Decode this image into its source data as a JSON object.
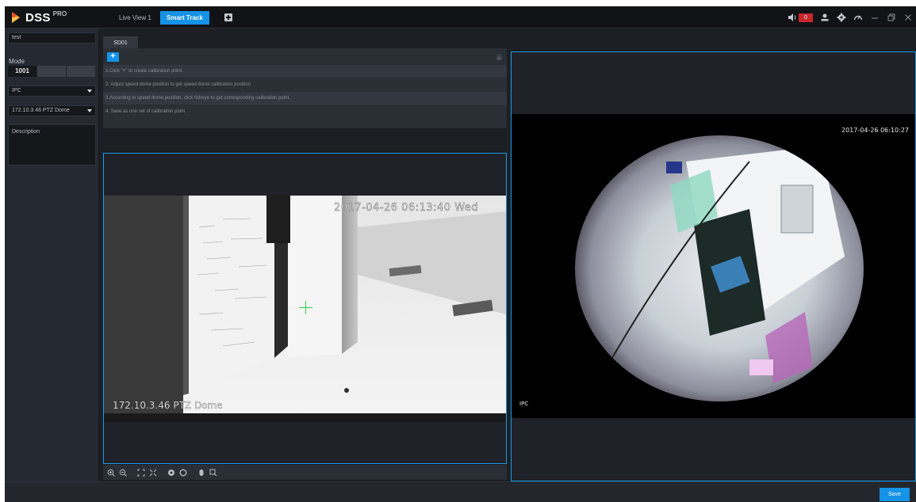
{
  "app": {
    "logo_text": "DSS",
    "logo_sup": "PRO",
    "brand_color": "#1593e6"
  },
  "header": {
    "tabs": [
      {
        "label": "Live View 1",
        "active": false
      },
      {
        "label": "Smart Track",
        "active": true
      }
    ],
    "add_tab_icon": "plus-square-icon",
    "alarm_count": "0",
    "icons": [
      "speaker-icon",
      "user-icon",
      "gear-icon",
      "gauge-icon",
      "minimize-icon",
      "restore-icon",
      "close-icon"
    ]
  },
  "left_panel": {
    "plan_name": "test",
    "mode_label": "Mode",
    "mode_options": [
      "1001",
      "",
      ""
    ],
    "device_select": "IPC",
    "channel_select": "172.10.3.46 PTZ Dome",
    "description_placeholder": "Description"
  },
  "calibration": {
    "tab_label": "SD01",
    "add_label": "+",
    "steps": [
      "1.Click \"+\" to create calibration point.",
      "2. Adjust speed dome position to get speed dome calibration position.",
      "3.According to speed dome position, click fisheye to get corresponding calibration point.",
      "4. Save as one set of calibration point."
    ]
  },
  "dome_video": {
    "osd_time": "2017-04-26 06:13:40 Wed",
    "channel_label": "172.10.3.46 PTZ Dome"
  },
  "fisheye_video": {
    "osd_time": "2017-04-26 06:10:27",
    "channel_label": "IPC"
  },
  "ptz_toolbar": {
    "icons": [
      "zoom-in-icon",
      "zoom-out-icon",
      "focus-near-icon",
      "focus-far-icon",
      "iris-open-icon",
      "iris-close-icon",
      "mouse-icon",
      "select-area-icon"
    ]
  },
  "footer": {
    "save_label": "Save"
  }
}
